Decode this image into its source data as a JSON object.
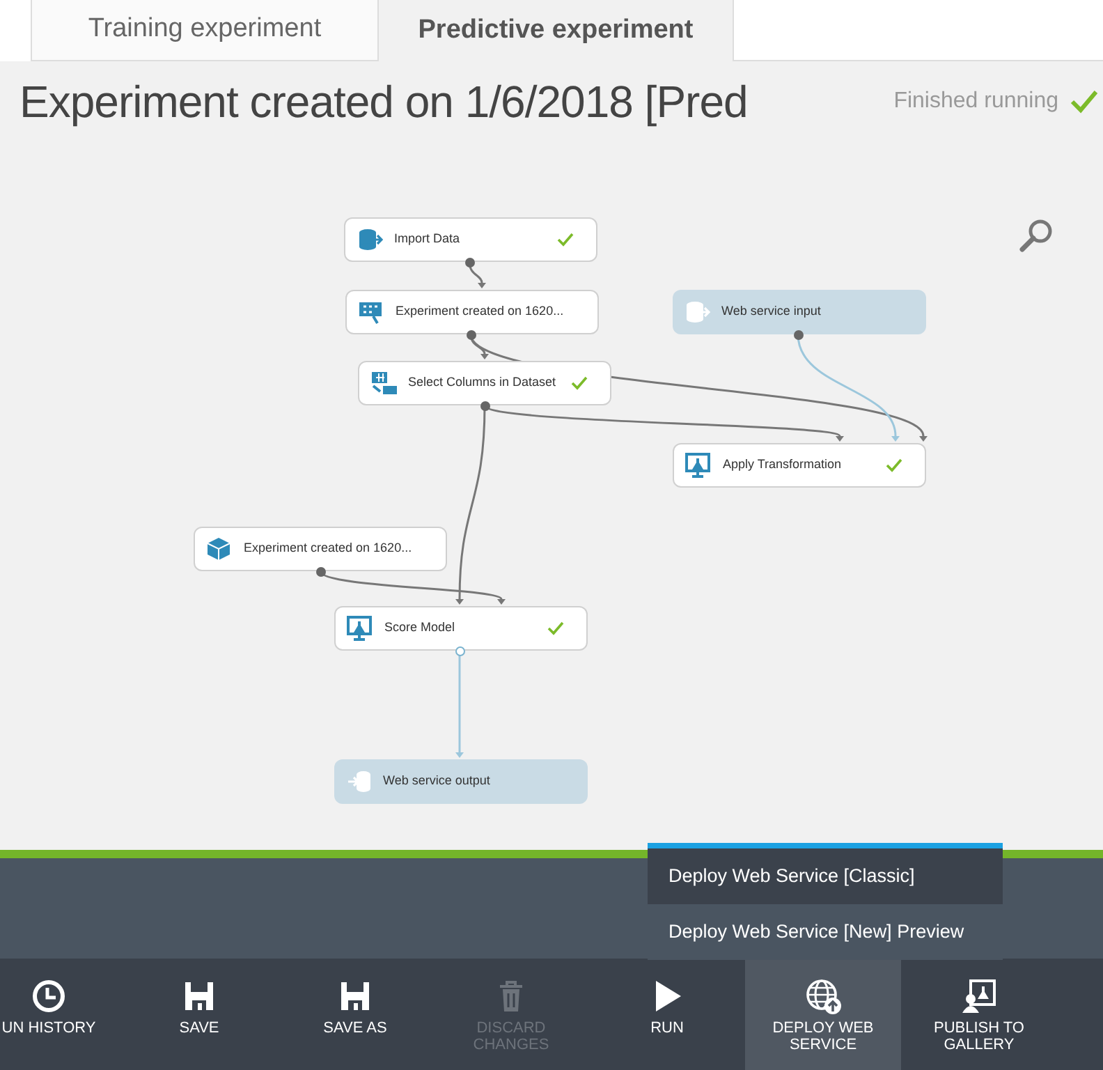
{
  "tabs": [
    {
      "label": "Training experiment",
      "selected": false
    },
    {
      "label": "Predictive experiment",
      "selected": true
    }
  ],
  "title": "Experiment created on 1/6/2018 [Pred",
  "run_status": {
    "label": "Finished running",
    "finished": true
  },
  "nodes": [
    {
      "label": "Import Data",
      "kind": "dataset",
      "finished": true
    },
    {
      "label": "Experiment created on 1620...",
      "kind": "transform",
      "finished": false
    },
    {
      "label": "Select Columns in Dataset",
      "kind": "select",
      "finished": true
    },
    {
      "label": "Web service input",
      "kind": "input",
      "finished": false
    },
    {
      "label": "Apply Transformation",
      "kind": "score",
      "finished": true
    },
    {
      "label": "Experiment created on 1620...",
      "kind": "model",
      "finished": false
    },
    {
      "label": "Score Model",
      "kind": "score",
      "finished": true
    },
    {
      "label": "Web service output",
      "kind": "output",
      "finished": false
    }
  ],
  "deploy_menu": [
    {
      "label": "Deploy Web Service [Classic]",
      "selected": true
    },
    {
      "label": "Deploy Web Service [New] Preview",
      "selected": false
    }
  ],
  "toolbar": [
    {
      "label": "UN HISTORY",
      "kind": "history",
      "disabled": false,
      "selected": false
    },
    {
      "label": "SAVE",
      "kind": "save",
      "disabled": false,
      "selected": false
    },
    {
      "label": "SAVE AS",
      "kind": "save",
      "disabled": false,
      "selected": false
    },
    {
      "label": "DISCARD CHANGES",
      "kind": "discard",
      "disabled": true,
      "selected": false
    },
    {
      "label": "RUN",
      "kind": "run",
      "disabled": false,
      "selected": false
    },
    {
      "label": "DEPLOY WEB SERVICE",
      "kind": "deploy",
      "disabled": false,
      "selected": true
    },
    {
      "label": "PUBLISH TO GALLERY",
      "kind": "publish",
      "disabled": false,
      "selected": false
    }
  ]
}
